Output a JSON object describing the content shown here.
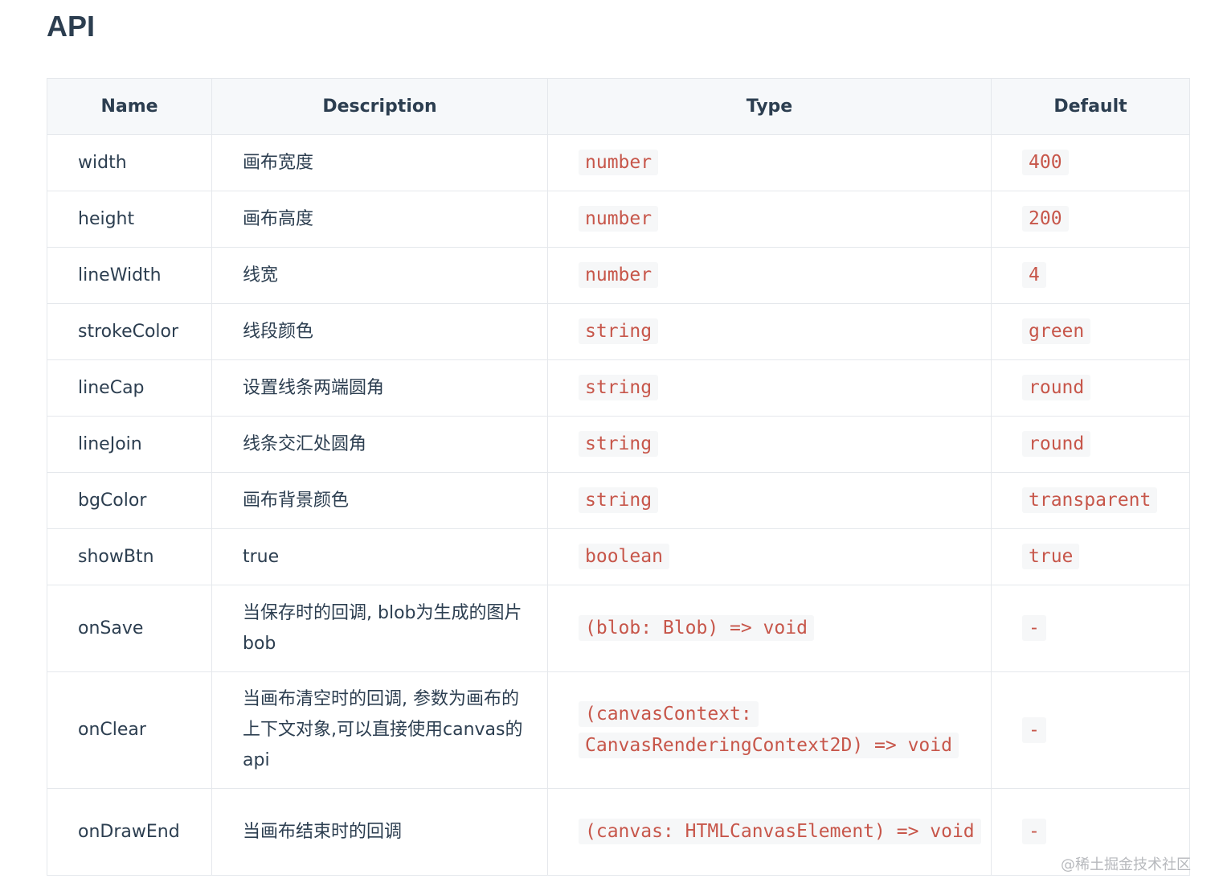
{
  "page": {
    "title": "API",
    "watermark": "@稀土掘金技术社区"
  },
  "table": {
    "headers": {
      "name": "Name",
      "description": "Description",
      "type": "Type",
      "default": "Default"
    },
    "rows": [
      {
        "name": "width",
        "description": "画布宽度",
        "type": "number",
        "default": "400"
      },
      {
        "name": "height",
        "description": "画布高度",
        "type": "number",
        "default": "200"
      },
      {
        "name": "lineWidth",
        "description": "线宽",
        "type": "number",
        "default": "4"
      },
      {
        "name": "strokeColor",
        "description": "线段颜色",
        "type": "string",
        "default": "green"
      },
      {
        "name": "lineCap",
        "description": "设置线条两端圆角",
        "type": "string",
        "default": "round"
      },
      {
        "name": "lineJoin",
        "description": "线条交汇处圆角",
        "type": "string",
        "default": "round"
      },
      {
        "name": "bgColor",
        "description": "画布背景颜色",
        "type": "string",
        "default": "transparent"
      },
      {
        "name": "showBtn",
        "description": "true",
        "type": "boolean",
        "default": "true"
      },
      {
        "name": "onSave",
        "description": "当保存时的回调, blob为生成的图片bob",
        "type": "(blob: Blob) => void",
        "default": "-"
      },
      {
        "name": "onClear",
        "description": "当画布清空时的回调, 参数为画布的上下文对象,可以直接使用canvas的api",
        "type": "(canvasContext: CanvasRenderingContext2D) => void",
        "default": "-"
      },
      {
        "name": "onDrawEnd",
        "description": "当画布结束时的回调",
        "type": "(canvas: HTMLCanvasElement) => void",
        "default": "-"
      }
    ]
  },
  "colors": {
    "text": "#2c3e50",
    "code_text": "#c7564a",
    "code_bg": "#f6f7f8",
    "header_bg": "#f6f8fa",
    "border": "#e5e8ec"
  }
}
